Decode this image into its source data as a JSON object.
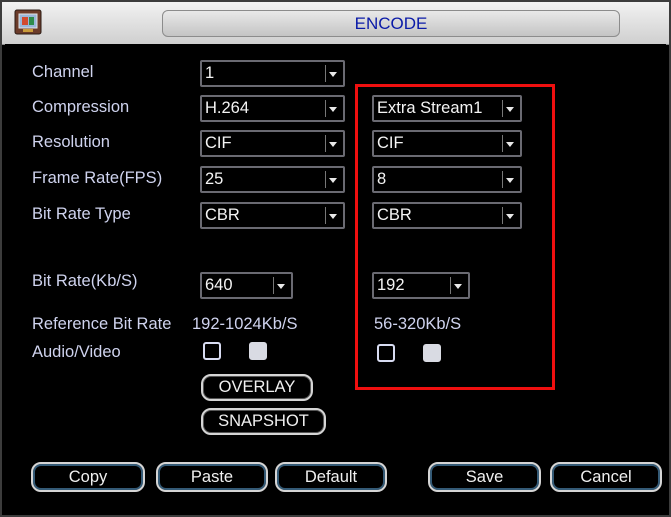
{
  "window": {
    "title": "ENCODE",
    "icon": "camera-icon"
  },
  "labels": {
    "channel": "Channel",
    "compression": "Compression",
    "resolution": "Resolution",
    "frame_rate": "Frame Rate(FPS)",
    "bit_rate_type": "Bit Rate Type",
    "bit_rate": "Bit Rate(Kb/S)",
    "reference_bit_rate": "Reference Bit Rate",
    "audio_video": "Audio/Video"
  },
  "main_stream": {
    "channel": "1",
    "compression": "H.264",
    "resolution": "CIF",
    "frame_rate": "25",
    "bit_rate_type": "CBR",
    "bit_rate": "640",
    "reference_bit_rate": "192-1024Kb/S",
    "audio_checked": false,
    "video_checked": true
  },
  "extra_stream": {
    "stream": "Extra Stream1",
    "resolution": "CIF",
    "frame_rate": "8",
    "bit_rate_type": "CBR",
    "bit_rate": "192",
    "reference_bit_rate": "56-320Kb/S",
    "audio_checked": false,
    "video_checked": true
  },
  "buttons": {
    "overlay": "OVERLAY",
    "snapshot": "SNAPSHOT",
    "copy": "Copy",
    "paste": "Paste",
    "default": "Default",
    "save": "Save",
    "cancel": "Cancel"
  },
  "colors": {
    "title_text": "#0a1aa8",
    "label_text": "#cfd3ee",
    "highlight_box": "#ef0f0f",
    "background": "#000000"
  }
}
